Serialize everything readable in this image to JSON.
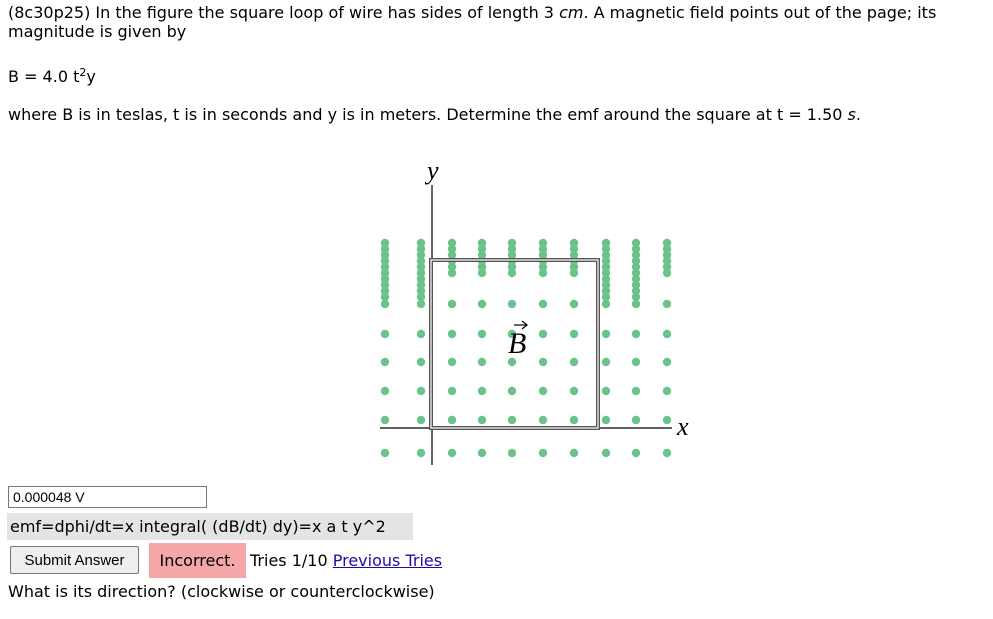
{
  "problem": {
    "line1": "(8c30p25) In the figure the square loop of wire has sides of length 3 ",
    "unit_cm": "cm",
    "line1_tail": ". A magnetic field points out of the page; its",
    "line2": "magnitude is given by",
    "formula_prefix": "B = 4.0 t",
    "formula_sup": "2",
    "formula_suffix": "y",
    "line3": "where B is in teslas, t is in seconds and y is in meters. Determine the emf around the square at t = 1.50 ",
    "unit_s": "s",
    "line3_tail": "."
  },
  "figure": {
    "y_label": "y",
    "x_label": "x",
    "b_label": "B",
    "dot_color": "#6ac48a"
  },
  "answer": {
    "value": "0.000048 V",
    "hint": "emf=dphi/dt=x integral( (dB/dt) dy)=x a t y^2",
    "submit_label": "Submit Answer",
    "status": "Incorrect.",
    "tries": "Tries 1/10",
    "previous_tries": "Previous Tries"
  },
  "question2": "What is its direction? (clockwise or counterclockwise)"
}
